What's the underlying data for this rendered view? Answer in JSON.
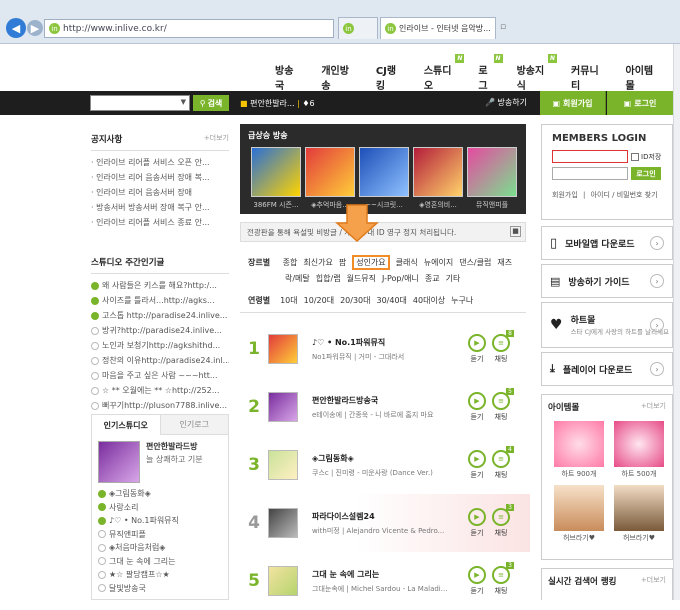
{
  "browser": {
    "url": "http://www.inlive.co.kr/",
    "tab_title": "인라이브 - 인터넷 음악방..."
  },
  "topmenu": [
    "방송국",
    "개인방송",
    "CJ랭킹",
    "스튜디오",
    "로그",
    "방송지식",
    "커뮤니티",
    "아이템몰"
  ],
  "searchbar": {
    "button": "검색",
    "ticker": "편안한발라...",
    "ticker_count": "6",
    "broadcast": "방송하기",
    "join": "회원가입",
    "login": "로그인"
  },
  "notice": {
    "title": "공지사항",
    "more": "+더보기",
    "items": [
      "인라이브 리어플 서비스 오픈 안...",
      "인라이브 리어 음송서버 장애 복...",
      "인라이브 리어 음송서버 장애",
      "방송서버 방송서버 장애 복구 안...",
      "인라이브 리어플 서비스 종료 안..."
    ]
  },
  "studio_week": {
    "title": "스튜디오 주간인기글",
    "items": [
      "왜 사람들은 키스를 해요?http:/...",
      "사이즈를 틀라서...http://agks...",
      "고스톱 http://paradise24.inlive...",
      "방귀?http://paradise24.inlive...",
      "노인과 보청기http://agkshithd...",
      "정찬의 이유http://paradise24.inl...",
      "마음을 주고 싶은 사람 ~~~htt...",
      "☆ ** 오월에는 ** ☆http://252...",
      "뻐꾸기http://pluson7788.inlive..."
    ]
  },
  "popular_studio": {
    "tab1": "인기스튜디오",
    "tab2": "인기로그",
    "featured": "편안한발라드방",
    "featured_desc": "늘 상쾌하고 기분",
    "items": [
      "◈그림동화◈",
      "사랑소리",
      "♪♡ • No.1파워뮤직",
      "뮤직앤피플",
      "◈처음마음처럼◈",
      "그대 눈 속에 그리는",
      "★☆ 팔당캠프☆★",
      "달빛방송국"
    ]
  },
  "rising": {
    "title": "급상승 방송",
    "items": [
      "386FM 시즌...",
      "◈추억마음...",
      "~~시크릿...",
      "◈영혼의비...",
      "뮤직앤피플"
    ]
  },
  "warning": "전광판을 통해 욕설및 비방글 / 개인에 대 ID 영구 정지 처리됩니다.",
  "genre": {
    "label": "장르별",
    "row1": [
      "종합",
      "최신가요",
      "팝",
      "성인가요",
      "클래식",
      "뉴에이지",
      "댄스/클럽",
      "재즈"
    ],
    "row2": [
      "락/메탈",
      "힙합/랩",
      "월드뮤직",
      "J-Pop/애니",
      "종교",
      "기타"
    ]
  },
  "age": {
    "label": "연령별",
    "items": [
      "10대",
      "10/20대",
      "20/30대",
      "30/40대",
      "40대이상",
      "누구나"
    ]
  },
  "rankings": [
    {
      "rank": "1",
      "title": "♪♡ • No.1파워뮤직",
      "station": "No1파워뮤직",
      "song": "거미 - 그대라서",
      "listeners": "8",
      "listen": "듣기",
      "chat": "채팅"
    },
    {
      "rank": "2",
      "title": "편안한발라드방송국",
      "station": "e테이송에",
      "song": "간종욱 - 니 바르에 홈지 마요",
      "listeners": "5",
      "listen": "듣기",
      "chat": "채팅"
    },
    {
      "rank": "3",
      "title": "◈그림동화◈",
      "station": "쿠스c",
      "song": "진미령 - 미운사랑 (Dance Ver.)",
      "listeners": "4",
      "listen": "듣기",
      "chat": "채팅"
    },
    {
      "rank": "4",
      "title": "파라다이스설렘24",
      "station": "with미정",
      "song": "Alejandro Vicente & Pedro...",
      "listeners": "3",
      "listen": "듣기",
      "chat": "채팅"
    },
    {
      "rank": "5",
      "title": "그대 눈 속에 그리는",
      "station": "그대눈속에",
      "song": "Michel Sardou - La Maladi...",
      "listeners": "3",
      "listen": "듣기",
      "chat": "채팅"
    }
  ],
  "members": {
    "title": "MEMBERS LOGIN",
    "id_save": "ID저장",
    "login_btn": "로그인",
    "join": "회원가입",
    "find": "아이디 / 비밀번호 찾기"
  },
  "side_buttons": [
    "모바일앱 다운로드",
    "방송하기 가이드",
    "하트몰",
    "플레이어 다운로드"
  ],
  "heartmall_desc": "스타 CJ에게 사랑의 하트를 날리세요",
  "itemmall": {
    "title": "아이템몰",
    "more": "+더보기",
    "items": [
      "하트 900개",
      "하트 500개",
      "허브라기♥",
      "허브라기♥"
    ]
  },
  "realtime": {
    "title": "실시간 검색어 랭킹",
    "more": "+더보기"
  },
  "colors": {
    "accent": "#7ab42a",
    "highlight": "#f28c28"
  }
}
